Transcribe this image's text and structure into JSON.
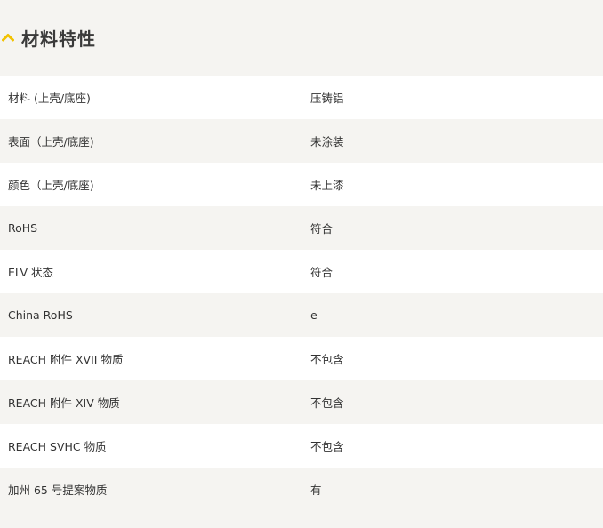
{
  "section": {
    "title": "材料特性",
    "icon": "chevron-up-icon",
    "accent_color": "#f2c200"
  },
  "properties": [
    {
      "label": "材料 (上壳/底座)",
      "value": "压铸铝"
    },
    {
      "label": "表面（上壳/底座)",
      "value": "未涂装"
    },
    {
      "label": "颜色（上壳/底座)",
      "value": "未上漆"
    },
    {
      "label": "RoHS",
      "value": "符合"
    },
    {
      "label": "ELV 状态",
      "value": "符合"
    },
    {
      "label": "China RoHS",
      "value": "e"
    },
    {
      "label": "REACH 附件 XVII 物质",
      "value": "不包含"
    },
    {
      "label": "REACH 附件 XIV 物质",
      "value": "不包含"
    },
    {
      "label": "REACH SVHC 物质",
      "value": "不包含"
    },
    {
      "label": "加州 65 号提案物质",
      "value": "有"
    }
  ]
}
